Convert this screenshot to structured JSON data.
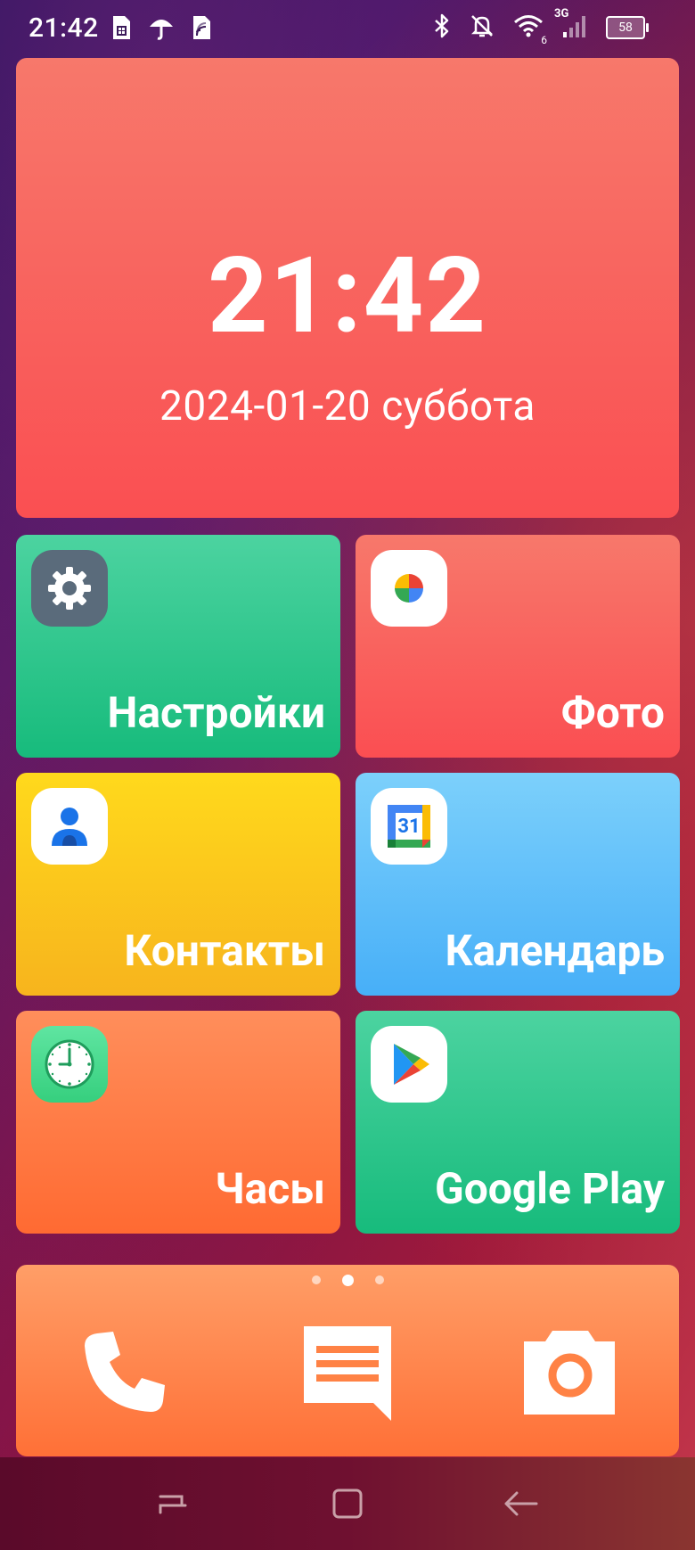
{
  "status_bar": {
    "time": "21:42",
    "network": "3G",
    "wifi_sub": "6",
    "battery": "58",
    "left_icons": [
      "sim-card-icon",
      "umbrella-icon",
      "sim-card-2-icon"
    ],
    "right_icons": [
      "bluetooth-icon",
      "notifications-off-icon",
      "wifi-icon",
      "signal-icon",
      "battery-icon"
    ]
  },
  "clock": {
    "time": "21:42",
    "date": "2024-01-20 суббота"
  },
  "apps": [
    {
      "label": "Настройки",
      "icon": "settings-gear-icon",
      "color": "#17bb7c"
    },
    {
      "label": "Фото",
      "icon": "google-photos-icon",
      "color": "#fb4e52"
    },
    {
      "label": "Контакты",
      "icon": "contacts-icon",
      "color": "#f7b41d"
    },
    {
      "label": "Календарь",
      "icon": "google-calendar-icon",
      "color": "#47aff8",
      "icon_text": "31"
    },
    {
      "label": "Часы",
      "icon": "clock-icon",
      "color": "#ff6a32"
    },
    {
      "label": "Google Play",
      "icon": "google-play-icon",
      "color": "#17bb7c"
    }
  ],
  "dock": {
    "page_count": 3,
    "active_page": 2,
    "buttons": [
      "phone-icon",
      "messages-icon",
      "camera-icon"
    ]
  },
  "nav_bar": {
    "buttons": [
      "recents-icon",
      "home-icon",
      "back-icon"
    ]
  }
}
